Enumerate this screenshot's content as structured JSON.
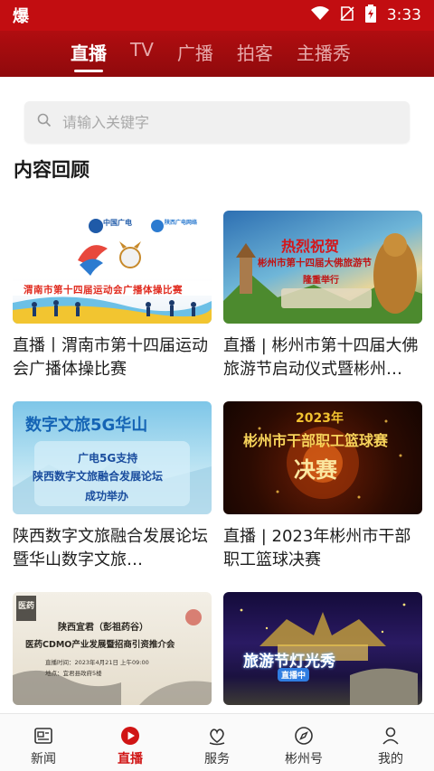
{
  "status_bar": {
    "app_glyph": "爆",
    "time": "3:33"
  },
  "tabs": [
    {
      "label": "直播",
      "active": true
    },
    {
      "label": "TV",
      "active": false
    },
    {
      "label": "广播",
      "active": false
    },
    {
      "label": "拍客",
      "active": false
    },
    {
      "label": "主播秀",
      "active": false
    }
  ],
  "search": {
    "placeholder": "请输入关键字"
  },
  "section_title": "内容回顾",
  "cards": [
    {
      "title": "直播丨渭南市第十四届运动会广播体操比赛",
      "thumb": {
        "logo1": "中国广电",
        "logo2": "陕西广电网络",
        "banner": "渭南市第十四届运动会广播体操比赛"
      }
    },
    {
      "title": "直播 | 彬州市第十四届大佛旅游节启动仪式暨彬州…",
      "thumb": {
        "line1": "热烈祝贺",
        "line2": "彬州市第十四届大佛旅游节",
        "line3": "隆重举行"
      }
    },
    {
      "title": "陕西数字文旅融合发展论坛暨华山数字文旅…",
      "thumb": {
        "heading": "数字文旅5G华山",
        "line1": "广电5G支持",
        "line2": "陕西数字文旅融合发展论坛",
        "line3": "成功举办"
      }
    },
    {
      "title": "直播 | 2023年彬州市干部职工篮球决赛",
      "thumb": {
        "year": "2023年",
        "line1": "彬州市干部职工篮球赛",
        "line2": "决赛"
      }
    },
    {
      "title": "",
      "thumb": {
        "line1": "陕西宜君（彭祖药谷）",
        "line2": "医药CDMO产业发展暨招商引资推介会",
        "line3": "直播时间：2023年4月21日 上午09:00",
        "line4": "地点：宜君县政府5楼",
        "corner": "医药"
      }
    },
    {
      "title": "",
      "thumb": {
        "line1": "旅游节灯光秀",
        "tag": "直播中"
      }
    }
  ],
  "bottom_nav": [
    {
      "label": "新闻",
      "icon": "news-icon",
      "active": false
    },
    {
      "label": "直播",
      "icon": "play-icon",
      "active": true
    },
    {
      "label": "服务",
      "icon": "service-icon",
      "active": false
    },
    {
      "label": "彬州号",
      "icon": "compass-icon",
      "active": false
    },
    {
      "label": "我的",
      "icon": "user-icon",
      "active": false
    }
  ],
  "colors": {
    "brand": "#c20d11",
    "active_nav": "#d01414"
  }
}
